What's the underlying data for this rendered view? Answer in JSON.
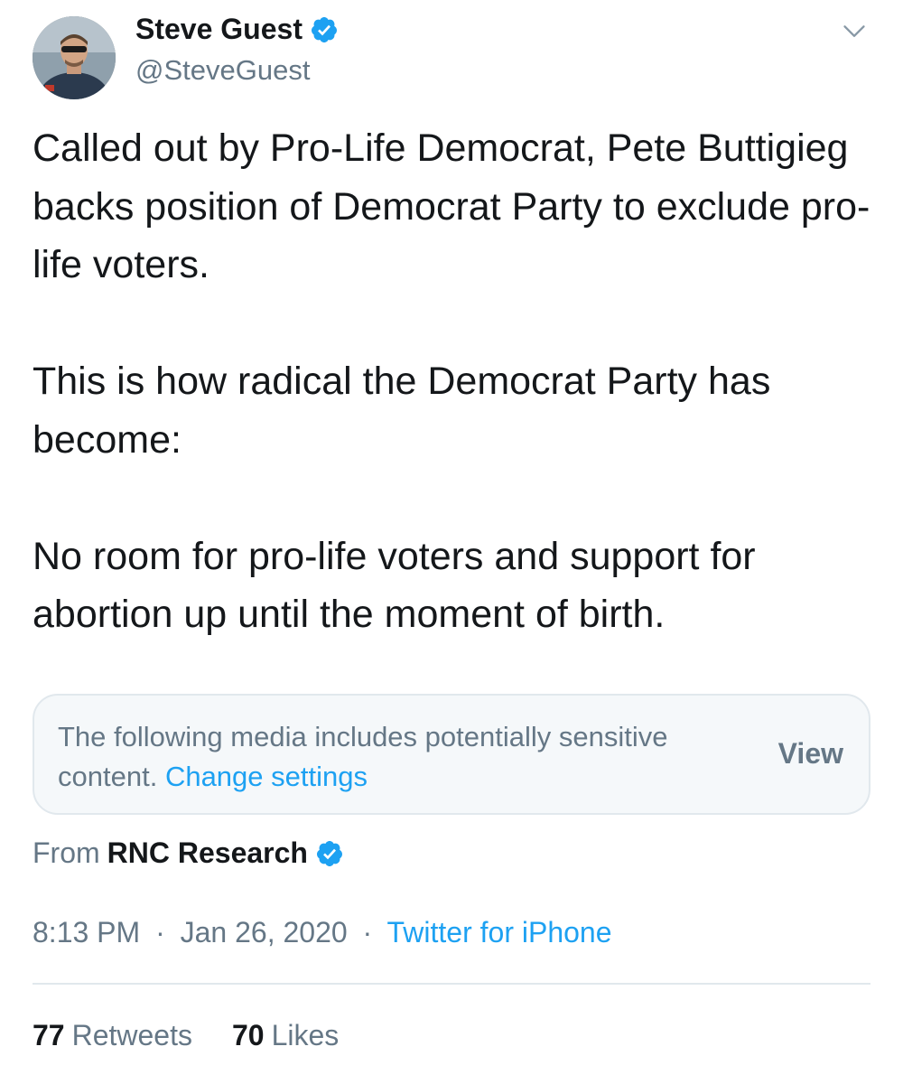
{
  "author": {
    "name": "Steve Guest",
    "handle": "@SteveGuest",
    "verified": true
  },
  "tweet": {
    "paragraphs": [
      "Called out by Pro-Life Democrat, Pete Buttigieg backs position of Democrat Party to exclude pro-life voters.",
      "This is how radical the Democrat Party has become:",
      "No room for pro-life voters and support for abortion up until the moment of birth."
    ]
  },
  "sensitive_notice": {
    "text": "The following media includes potentially sensitive content.",
    "link": "Change settings",
    "button": "View"
  },
  "source": {
    "prefix": "From",
    "name": "RNC Research",
    "verified": true
  },
  "meta": {
    "time": "8:13 PM",
    "separator": "·",
    "date": "Jan 26, 2020",
    "client": "Twitter for iPhone"
  },
  "stats": {
    "retweets_count": "77",
    "retweets_label": "Retweets",
    "likes_count": "70",
    "likes_label": "Likes"
  },
  "colors": {
    "accent": "#1da1f2",
    "secondary_text": "#657786",
    "primary_text": "#14171a",
    "panel_bg": "#f5f8fa",
    "border": "#e1e8ed"
  },
  "icons": {
    "verified": "verified-badge-icon",
    "menu": "chevron-down-icon"
  }
}
